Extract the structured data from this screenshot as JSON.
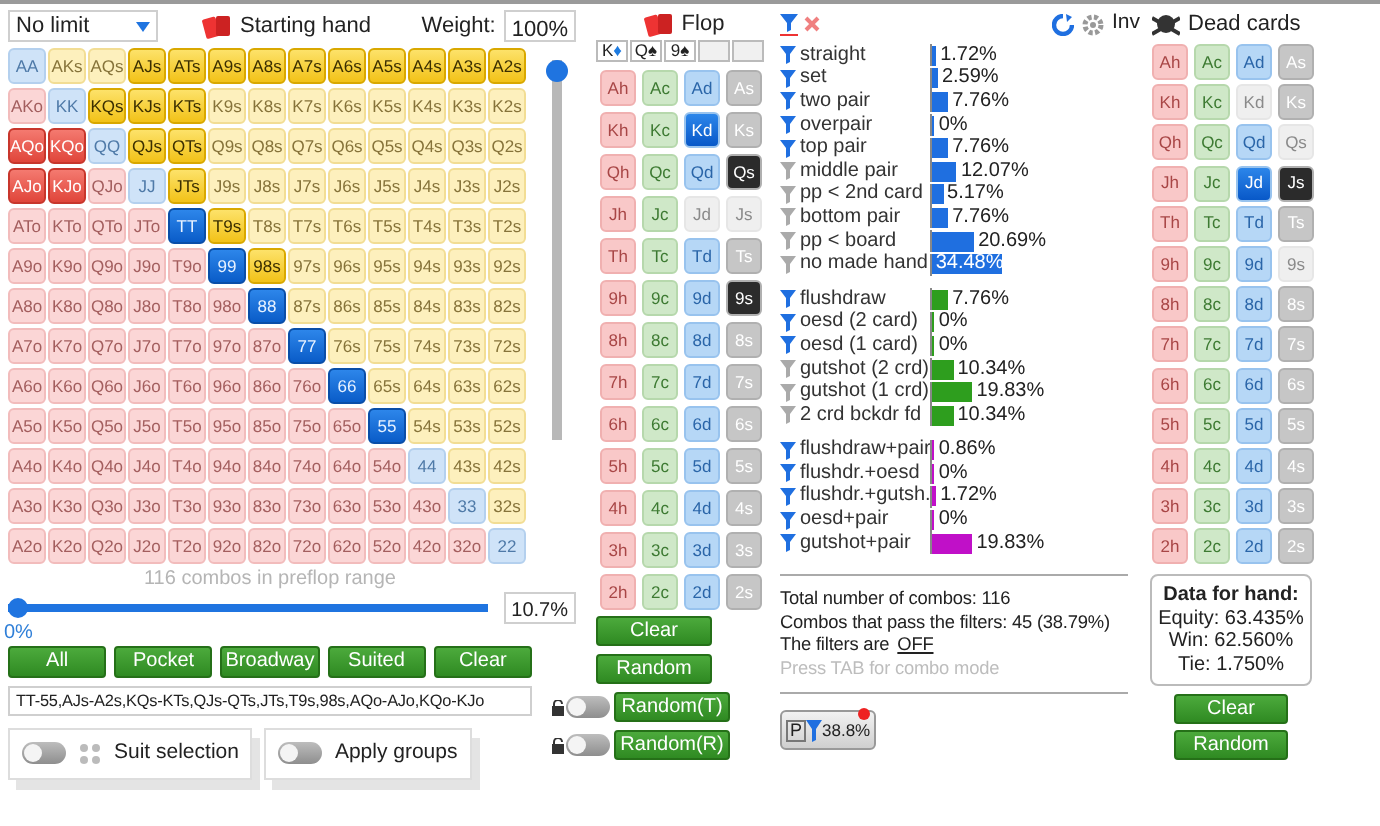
{
  "game_select": {
    "value": "No limit"
  },
  "starting_hand": {
    "title": "Starting hand",
    "weight_label": "Weight:",
    "weight": "100%"
  },
  "weight_slider": {
    "level": 1
  },
  "hand_grid": [
    [
      {
        "label": "AA",
        "selected": false
      },
      {
        "label": "AKs",
        "selected": false
      },
      {
        "label": "AQs",
        "selected": false
      },
      {
        "label": "AJs",
        "selected": true
      },
      {
        "label": "ATs",
        "selected": true
      },
      {
        "label": "A9s",
        "selected": true
      },
      {
        "label": "A8s",
        "selected": true
      },
      {
        "label": "A7s",
        "selected": true
      },
      {
        "label": "A6s",
        "selected": true
      },
      {
        "label": "A5s",
        "selected": true
      },
      {
        "label": "A4s",
        "selected": true
      },
      {
        "label": "A3s",
        "selected": true
      },
      {
        "label": "A2s",
        "selected": true
      }
    ],
    [
      {
        "label": "AKo",
        "selected": false
      },
      {
        "label": "KK",
        "selected": false
      },
      {
        "label": "KQs",
        "selected": true
      },
      {
        "label": "KJs",
        "selected": true
      },
      {
        "label": "KTs",
        "selected": true
      },
      {
        "label": "K9s",
        "selected": false
      },
      {
        "label": "K8s",
        "selected": false
      },
      {
        "label": "K7s",
        "selected": false
      },
      {
        "label": "K6s",
        "selected": false
      },
      {
        "label": "K5s",
        "selected": false
      },
      {
        "label": "K4s",
        "selected": false
      },
      {
        "label": "K3s",
        "selected": false
      },
      {
        "label": "K2s",
        "selected": false
      }
    ],
    [
      {
        "label": "AQo",
        "selected": true
      },
      {
        "label": "KQo",
        "selected": true
      },
      {
        "label": "QQ",
        "selected": false
      },
      {
        "label": "QJs",
        "selected": true
      },
      {
        "label": "QTs",
        "selected": true
      },
      {
        "label": "Q9s",
        "selected": false
      },
      {
        "label": "Q8s",
        "selected": false
      },
      {
        "label": "Q7s",
        "selected": false
      },
      {
        "label": "Q6s",
        "selected": false
      },
      {
        "label": "Q5s",
        "selected": false
      },
      {
        "label": "Q4s",
        "selected": false
      },
      {
        "label": "Q3s",
        "selected": false
      },
      {
        "label": "Q2s",
        "selected": false
      }
    ],
    [
      {
        "label": "AJo",
        "selected": true
      },
      {
        "label": "KJo",
        "selected": true
      },
      {
        "label": "QJo",
        "selected": false
      },
      {
        "label": "JJ",
        "selected": false
      },
      {
        "label": "JTs",
        "selected": true
      },
      {
        "label": "J9s",
        "selected": false
      },
      {
        "label": "J8s",
        "selected": false
      },
      {
        "label": "J7s",
        "selected": false
      },
      {
        "label": "J6s",
        "selected": false
      },
      {
        "label": "J5s",
        "selected": false
      },
      {
        "label": "J4s",
        "selected": false
      },
      {
        "label": "J3s",
        "selected": false
      },
      {
        "label": "J2s",
        "selected": false
      }
    ],
    [
      {
        "label": "ATo",
        "selected": false
      },
      {
        "label": "KTo",
        "selected": false
      },
      {
        "label": "QTo",
        "selected": false
      },
      {
        "label": "JTo",
        "selected": false
      },
      {
        "label": "TT",
        "selected": true
      },
      {
        "label": "T9s",
        "selected": true
      },
      {
        "label": "T8s",
        "selected": false
      },
      {
        "label": "T7s",
        "selected": false
      },
      {
        "label": "T6s",
        "selected": false
      },
      {
        "label": "T5s",
        "selected": false
      },
      {
        "label": "T4s",
        "selected": false
      },
      {
        "label": "T3s",
        "selected": false
      },
      {
        "label": "T2s",
        "selected": false
      }
    ],
    [
      {
        "label": "A9o",
        "selected": false
      },
      {
        "label": "K9o",
        "selected": false
      },
      {
        "label": "Q9o",
        "selected": false
      },
      {
        "label": "J9o",
        "selected": false
      },
      {
        "label": "T9o",
        "selected": false
      },
      {
        "label": "99",
        "selected": true
      },
      {
        "label": "98s",
        "selected": true
      },
      {
        "label": "97s",
        "selected": false
      },
      {
        "label": "96s",
        "selected": false
      },
      {
        "label": "95s",
        "selected": false
      },
      {
        "label": "94s",
        "selected": false
      },
      {
        "label": "93s",
        "selected": false
      },
      {
        "label": "92s",
        "selected": false
      }
    ],
    [
      {
        "label": "A8o",
        "selected": false
      },
      {
        "label": "K8o",
        "selected": false
      },
      {
        "label": "Q8o",
        "selected": false
      },
      {
        "label": "J8o",
        "selected": false
      },
      {
        "label": "T8o",
        "selected": false
      },
      {
        "label": "98o",
        "selected": false
      },
      {
        "label": "88",
        "selected": true
      },
      {
        "label": "87s",
        "selected": false
      },
      {
        "label": "86s",
        "selected": false
      },
      {
        "label": "85s",
        "selected": false
      },
      {
        "label": "84s",
        "selected": false
      },
      {
        "label": "83s",
        "selected": false
      },
      {
        "label": "82s",
        "selected": false
      }
    ],
    [
      {
        "label": "A7o",
        "selected": false
      },
      {
        "label": "K7o",
        "selected": false
      },
      {
        "label": "Q7o",
        "selected": false
      },
      {
        "label": "J7o",
        "selected": false
      },
      {
        "label": "T7o",
        "selected": false
      },
      {
        "label": "97o",
        "selected": false
      },
      {
        "label": "87o",
        "selected": false
      },
      {
        "label": "77",
        "selected": true
      },
      {
        "label": "76s",
        "selected": false
      },
      {
        "label": "75s",
        "selected": false
      },
      {
        "label": "74s",
        "selected": false
      },
      {
        "label": "73s",
        "selected": false
      },
      {
        "label": "72s",
        "selected": false
      }
    ],
    [
      {
        "label": "A6o",
        "selected": false
      },
      {
        "label": "K6o",
        "selected": false
      },
      {
        "label": "Q6o",
        "selected": false
      },
      {
        "label": "J6o",
        "selected": false
      },
      {
        "label": "T6o",
        "selected": false
      },
      {
        "label": "96o",
        "selected": false
      },
      {
        "label": "86o",
        "selected": false
      },
      {
        "label": "76o",
        "selected": false
      },
      {
        "label": "66",
        "selected": true
      },
      {
        "label": "65s",
        "selected": false
      },
      {
        "label": "64s",
        "selected": false
      },
      {
        "label": "63s",
        "selected": false
      },
      {
        "label": "62s",
        "selected": false
      }
    ],
    [
      {
        "label": "A5o",
        "selected": false
      },
      {
        "label": "K5o",
        "selected": false
      },
      {
        "label": "Q5o",
        "selected": false
      },
      {
        "label": "J5o",
        "selected": false
      },
      {
        "label": "T5o",
        "selected": false
      },
      {
        "label": "95o",
        "selected": false
      },
      {
        "label": "85o",
        "selected": false
      },
      {
        "label": "75o",
        "selected": false
      },
      {
        "label": "65o",
        "selected": false
      },
      {
        "label": "55",
        "selected": true
      },
      {
        "label": "54s",
        "selected": false
      },
      {
        "label": "53s",
        "selected": false
      },
      {
        "label": "52s",
        "selected": false
      }
    ],
    [
      {
        "label": "A4o",
        "selected": false
      },
      {
        "label": "K4o",
        "selected": false
      },
      {
        "label": "Q4o",
        "selected": false
      },
      {
        "label": "J4o",
        "selected": false
      },
      {
        "label": "T4o",
        "selected": false
      },
      {
        "label": "94o",
        "selected": false
      },
      {
        "label": "84o",
        "selected": false
      },
      {
        "label": "74o",
        "selected": false
      },
      {
        "label": "64o",
        "selected": false
      },
      {
        "label": "54o",
        "selected": false
      },
      {
        "label": "44",
        "selected": false
      },
      {
        "label": "43s",
        "selected": false
      },
      {
        "label": "42s",
        "selected": false
      }
    ],
    [
      {
        "label": "A3o",
        "selected": false
      },
      {
        "label": "K3o",
        "selected": false
      },
      {
        "label": "Q3o",
        "selected": false
      },
      {
        "label": "J3o",
        "selected": false
      },
      {
        "label": "T3o",
        "selected": false
      },
      {
        "label": "93o",
        "selected": false
      },
      {
        "label": "83o",
        "selected": false
      },
      {
        "label": "73o",
        "selected": false
      },
      {
        "label": "63o",
        "selected": false
      },
      {
        "label": "53o",
        "selected": false
      },
      {
        "label": "43o",
        "selected": false
      },
      {
        "label": "33",
        "selected": false
      },
      {
        "label": "32s",
        "selected": false
      }
    ],
    [
      {
        "label": "A2o",
        "selected": false
      },
      {
        "label": "K2o",
        "selected": false
      },
      {
        "label": "Q2o",
        "selected": false
      },
      {
        "label": "J2o",
        "selected": false
      },
      {
        "label": "T2o",
        "selected": false
      },
      {
        "label": "92o",
        "selected": false
      },
      {
        "label": "82o",
        "selected": false
      },
      {
        "label": "72o",
        "selected": false
      },
      {
        "label": "62o",
        "selected": false
      },
      {
        "label": "52o",
        "selected": false
      },
      {
        "label": "42o",
        "selected": false
      },
      {
        "label": "32o",
        "selected": false
      },
      {
        "label": "22",
        "selected": false
      }
    ]
  ],
  "range_slider": {
    "caption": "116 combos in preflop range",
    "level": 0,
    "min_label": "0%",
    "value": "10.7%"
  },
  "range_buttons": [
    "All",
    "Pocket",
    "Broadway",
    "Suited",
    "Clear"
  ],
  "range_text": "TT-55,AJs-A2s,KQs-KTs,QJs-QTs,JTs,T9s,98s,AQo-AJo,KQo-KJo",
  "toggles": [
    {
      "label": "Suit selection",
      "on": false,
      "kind": "suits"
    },
    {
      "label": "Apply groups",
      "on": false,
      "kind": "plain"
    }
  ],
  "flop": {
    "title": "Flop",
    "slots": [
      {
        "filled": true,
        "rank": "K",
        "suit": "♦",
        "color": "#1e7be0"
      },
      {
        "filled": true,
        "rank": "Q",
        "suit": "♠",
        "color": "#222222"
      },
      {
        "filled": true,
        "rank": "9",
        "suit": "♠",
        "color": "#222222"
      },
      {
        "filled": false
      },
      {
        "filled": false
      }
    ],
    "cards": [
      [
        {
          "label": "Ah",
          "selected": false,
          "disabled": false
        },
        {
          "label": "Ac",
          "selected": false,
          "disabled": false
        },
        {
          "label": "Ad",
          "selected": false,
          "disabled": false
        },
        {
          "label": "As",
          "selected": false,
          "disabled": false
        }
      ],
      [
        {
          "label": "Kh",
          "selected": false,
          "disabled": false
        },
        {
          "label": "Kc",
          "selected": false,
          "disabled": false
        },
        {
          "label": "Kd",
          "selected": true,
          "disabled": false
        },
        {
          "label": "Ks",
          "selected": false,
          "disabled": false
        }
      ],
      [
        {
          "label": "Qh",
          "selected": false,
          "disabled": false
        },
        {
          "label": "Qc",
          "selected": false,
          "disabled": false
        },
        {
          "label": "Qd",
          "selected": false,
          "disabled": false
        },
        {
          "label": "Qs",
          "selected": true,
          "disabled": false
        }
      ],
      [
        {
          "label": "Jh",
          "selected": false,
          "disabled": false
        },
        {
          "label": "Jc",
          "selected": false,
          "disabled": false
        },
        {
          "label": "Jd",
          "selected": false,
          "disabled": true
        },
        {
          "label": "Js",
          "selected": false,
          "disabled": true
        }
      ],
      [
        {
          "label": "Th",
          "selected": false,
          "disabled": false
        },
        {
          "label": "Tc",
          "selected": false,
          "disabled": false
        },
        {
          "label": "Td",
          "selected": false,
          "disabled": false
        },
        {
          "label": "Ts",
          "selected": false,
          "disabled": false
        }
      ],
      [
        {
          "label": "9h",
          "selected": false,
          "disabled": false
        },
        {
          "label": "9c",
          "selected": false,
          "disabled": false
        },
        {
          "label": "9d",
          "selected": false,
          "disabled": false
        },
        {
          "label": "9s",
          "selected": true,
          "disabled": false
        }
      ],
      [
        {
          "label": "8h",
          "selected": false,
          "disabled": false
        },
        {
          "label": "8c",
          "selected": false,
          "disabled": false
        },
        {
          "label": "8d",
          "selected": false,
          "disabled": false
        },
        {
          "label": "8s",
          "selected": false,
          "disabled": false
        }
      ],
      [
        {
          "label": "7h",
          "selected": false,
          "disabled": false
        },
        {
          "label": "7c",
          "selected": false,
          "disabled": false
        },
        {
          "label": "7d",
          "selected": false,
          "disabled": false
        },
        {
          "label": "7s",
          "selected": false,
          "disabled": false
        }
      ],
      [
        {
          "label": "6h",
          "selected": false,
          "disabled": false
        },
        {
          "label": "6c",
          "selected": false,
          "disabled": false
        },
        {
          "label": "6d",
          "selected": false,
          "disabled": false
        },
        {
          "label": "6s",
          "selected": false,
          "disabled": false
        }
      ],
      [
        {
          "label": "5h",
          "selected": false,
          "disabled": false
        },
        {
          "label": "5c",
          "selected": false,
          "disabled": false
        },
        {
          "label": "5d",
          "selected": false,
          "disabled": false
        },
        {
          "label": "5s",
          "selected": false,
          "disabled": false
        }
      ],
      [
        {
          "label": "4h",
          "selected": false,
          "disabled": false
        },
        {
          "label": "4c",
          "selected": false,
          "disabled": false
        },
        {
          "label": "4d",
          "selected": false,
          "disabled": false
        },
        {
          "label": "4s",
          "selected": false,
          "disabled": false
        }
      ],
      [
        {
          "label": "3h",
          "selected": false,
          "disabled": false
        },
        {
          "label": "3c",
          "selected": false,
          "disabled": false
        },
        {
          "label": "3d",
          "selected": false,
          "disabled": false
        },
        {
          "label": "3s",
          "selected": false,
          "disabled": false
        }
      ],
      [
        {
          "label": "2h",
          "selected": false,
          "disabled": false
        },
        {
          "label": "2c",
          "selected": false,
          "disabled": false
        },
        {
          "label": "2d",
          "selected": false,
          "disabled": false
        },
        {
          "label": "2s",
          "selected": false,
          "disabled": false
        }
      ]
    ],
    "buttons": [
      {
        "label": "Clear",
        "kind": "plain"
      },
      {
        "label": "Random",
        "kind": "plain"
      },
      {
        "label": "Random(T)",
        "kind": "locked",
        "on": false
      },
      {
        "label": "Random(R)",
        "kind": "locked",
        "on": false
      }
    ]
  },
  "filter_groups": [
    {
      "color": "#1f6fe0",
      "items": [
        {
          "label": "straight",
          "on": true,
          "value": "1.72%",
          "level": 0.0172,
          "selected": false
        },
        {
          "label": "set",
          "on": true,
          "value": "2.59%",
          "level": 0.0259,
          "selected": false
        },
        {
          "label": "two pair",
          "on": true,
          "value": "7.76%",
          "level": 0.0776,
          "selected": false
        },
        {
          "label": "overpair",
          "on": true,
          "value": "0%",
          "level": 0,
          "selected": false
        },
        {
          "label": "top pair",
          "on": true,
          "value": "7.76%",
          "level": 0.0776,
          "selected": false
        },
        {
          "label": "middle pair",
          "on": false,
          "value": "12.07%",
          "level": 0.1207,
          "selected": false
        },
        {
          "label": "pp < 2nd card",
          "on": false,
          "value": "5.17%",
          "level": 0.0517,
          "selected": false
        },
        {
          "label": "bottom pair",
          "on": false,
          "value": "7.76%",
          "level": 0.0776,
          "selected": false
        },
        {
          "label": "pp < board",
          "on": false,
          "value": "20.69%",
          "level": 0.2069,
          "selected": false
        },
        {
          "label": "no made hand",
          "on": false,
          "value": "34.48%",
          "level": 0.3448,
          "selected": true
        }
      ]
    },
    {
      "color": "#2e9e1e",
      "items": [
        {
          "label": "flushdraw",
          "on": true,
          "value": "7.76%",
          "level": 0.0776,
          "selected": false
        },
        {
          "label": "oesd (2 card)",
          "on": true,
          "value": "0%",
          "level": 0,
          "selected": false
        },
        {
          "label": "oesd (1 card)",
          "on": true,
          "value": "0%",
          "level": 0,
          "selected": false
        },
        {
          "label": "gutshot (2 crd)",
          "on": false,
          "value": "10.34%",
          "level": 0.1034,
          "selected": false
        },
        {
          "label": "gutshot (1 crd)",
          "on": false,
          "value": "19.83%",
          "level": 0.1983,
          "selected": false
        },
        {
          "label": "2 crd bckdr fd",
          "on": false,
          "value": "10.34%",
          "level": 0.1034,
          "selected": false
        }
      ]
    },
    {
      "color": "#c010c8",
      "items": [
        {
          "label": "flushdraw+pair",
          "on": true,
          "value": "0.86%",
          "level": 0.0086,
          "selected": false
        },
        {
          "label": "flushdr.+oesd",
          "on": true,
          "value": "0%",
          "level": 0,
          "selected": false
        },
        {
          "label": "flushdr.+gutsh.",
          "on": true,
          "value": "1.72%",
          "level": 0.0172,
          "selected": false
        },
        {
          "label": "oesd+pair",
          "on": true,
          "value": "0%",
          "level": 0,
          "selected": false
        },
        {
          "label": "gutshot+pair",
          "on": true,
          "value": "19.83%",
          "level": 0.1983,
          "selected": false
        }
      ]
    }
  ],
  "stats": {
    "total": "Total number of combos: 116",
    "pass": "Combos that pass the filters: 45 (38.79%)",
    "filters_prefix": "The filters are",
    "filters_state": "OFF",
    "hint": "Press TAB for combo mode"
  },
  "filter_badge": {
    "letter": "P",
    "value": "38.8%"
  },
  "toolbar": {
    "inv_label": "Inv"
  },
  "dead": {
    "title": "Dead cards",
    "cards": [
      [
        {
          "label": "Ah",
          "selected": false,
          "disabled": false
        },
        {
          "label": "Ac",
          "selected": false,
          "disabled": false
        },
        {
          "label": "Ad",
          "selected": false,
          "disabled": false
        },
        {
          "label": "As",
          "selected": false,
          "disabled": false
        }
      ],
      [
        {
          "label": "Kh",
          "selected": false,
          "disabled": false
        },
        {
          "label": "Kc",
          "selected": false,
          "disabled": false
        },
        {
          "label": "Kd",
          "selected": false,
          "disabled": true
        },
        {
          "label": "Ks",
          "selected": false,
          "disabled": false
        }
      ],
      [
        {
          "label": "Qh",
          "selected": false,
          "disabled": false
        },
        {
          "label": "Qc",
          "selected": false,
          "disabled": false
        },
        {
          "label": "Qd",
          "selected": false,
          "disabled": false
        },
        {
          "label": "Qs",
          "selected": false,
          "disabled": true
        }
      ],
      [
        {
          "label": "Jh",
          "selected": false,
          "disabled": false
        },
        {
          "label": "Jc",
          "selected": false,
          "disabled": false
        },
        {
          "label": "Jd",
          "selected": true,
          "disabled": false
        },
        {
          "label": "Js",
          "selected": true,
          "disabled": false
        }
      ],
      [
        {
          "label": "Th",
          "selected": false,
          "disabled": false
        },
        {
          "label": "Tc",
          "selected": false,
          "disabled": false
        },
        {
          "label": "Td",
          "selected": false,
          "disabled": false
        },
        {
          "label": "Ts",
          "selected": false,
          "disabled": false
        }
      ],
      [
        {
          "label": "9h",
          "selected": false,
          "disabled": false
        },
        {
          "label": "9c",
          "selected": false,
          "disabled": false
        },
        {
          "label": "9d",
          "selected": false,
          "disabled": false
        },
        {
          "label": "9s",
          "selected": false,
          "disabled": true
        }
      ],
      [
        {
          "label": "8h",
          "selected": false,
          "disabled": false
        },
        {
          "label": "8c",
          "selected": false,
          "disabled": false
        },
        {
          "label": "8d",
          "selected": false,
          "disabled": false
        },
        {
          "label": "8s",
          "selected": false,
          "disabled": false
        }
      ],
      [
        {
          "label": "7h",
          "selected": false,
          "disabled": false
        },
        {
          "label": "7c",
          "selected": false,
          "disabled": false
        },
        {
          "label": "7d",
          "selected": false,
          "disabled": false
        },
        {
          "label": "7s",
          "selected": false,
          "disabled": false
        }
      ],
      [
        {
          "label": "6h",
          "selected": false,
          "disabled": false
        },
        {
          "label": "6c",
          "selected": false,
          "disabled": false
        },
        {
          "label": "6d",
          "selected": false,
          "disabled": false
        },
        {
          "label": "6s",
          "selected": false,
          "disabled": false
        }
      ],
      [
        {
          "label": "5h",
          "selected": false,
          "disabled": false
        },
        {
          "label": "5c",
          "selected": false,
          "disabled": false
        },
        {
          "label": "5d",
          "selected": false,
          "disabled": false
        },
        {
          "label": "5s",
          "selected": false,
          "disabled": false
        }
      ],
      [
        {
          "label": "4h",
          "selected": false,
          "disabled": false
        },
        {
          "label": "4c",
          "selected": false,
          "disabled": false
        },
        {
          "label": "4d",
          "selected": false,
          "disabled": false
        },
        {
          "label": "4s",
          "selected": false,
          "disabled": false
        }
      ],
      [
        {
          "label": "3h",
          "selected": false,
          "disabled": false
        },
        {
          "label": "3c",
          "selected": false,
          "disabled": false
        },
        {
          "label": "3d",
          "selected": false,
          "disabled": false
        },
        {
          "label": "3s",
          "selected": false,
          "disabled": false
        }
      ],
      [
        {
          "label": "2h",
          "selected": false,
          "disabled": false
        },
        {
          "label": "2c",
          "selected": false,
          "disabled": false
        },
        {
          "label": "2d",
          "selected": false,
          "disabled": false
        },
        {
          "label": "2s",
          "selected": false,
          "disabled": false
        }
      ]
    ],
    "data_box": {
      "title": "Data for hand:",
      "lines": [
        "Equity: 63.435%",
        "Win: 62.560%",
        "Tie: 1.750%"
      ]
    },
    "buttons": [
      "Clear",
      "Random"
    ]
  }
}
